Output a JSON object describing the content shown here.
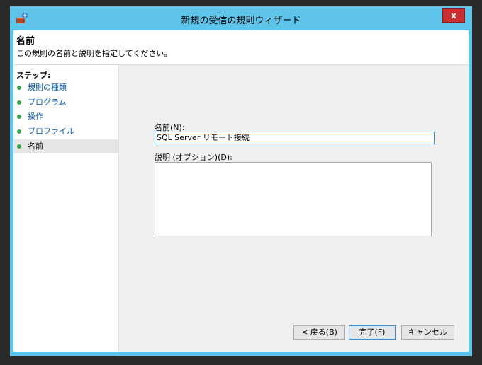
{
  "window": {
    "title": "新規の受信の規則ウィザード",
    "close_label": "x",
    "frame_color": "#5ec4e9"
  },
  "header": {
    "title": "名前",
    "description": "この規則の名前と説明を指定してください。"
  },
  "steps": {
    "title": "ステップ:",
    "items": [
      {
        "label": "規則の種類",
        "active": false
      },
      {
        "label": "プログラム",
        "active": false
      },
      {
        "label": "操作",
        "active": false
      },
      {
        "label": "プロファイル",
        "active": false
      },
      {
        "label": "名前",
        "active": true
      }
    ]
  },
  "form": {
    "name_label": "名前(N):",
    "name_value": "SQL Server リモート接続",
    "desc_label": "説明 (オプション)(D):",
    "desc_value": ""
  },
  "buttons": {
    "back": "< 戻る(B)",
    "finish": "完了(F)",
    "cancel": "キャンセル"
  }
}
